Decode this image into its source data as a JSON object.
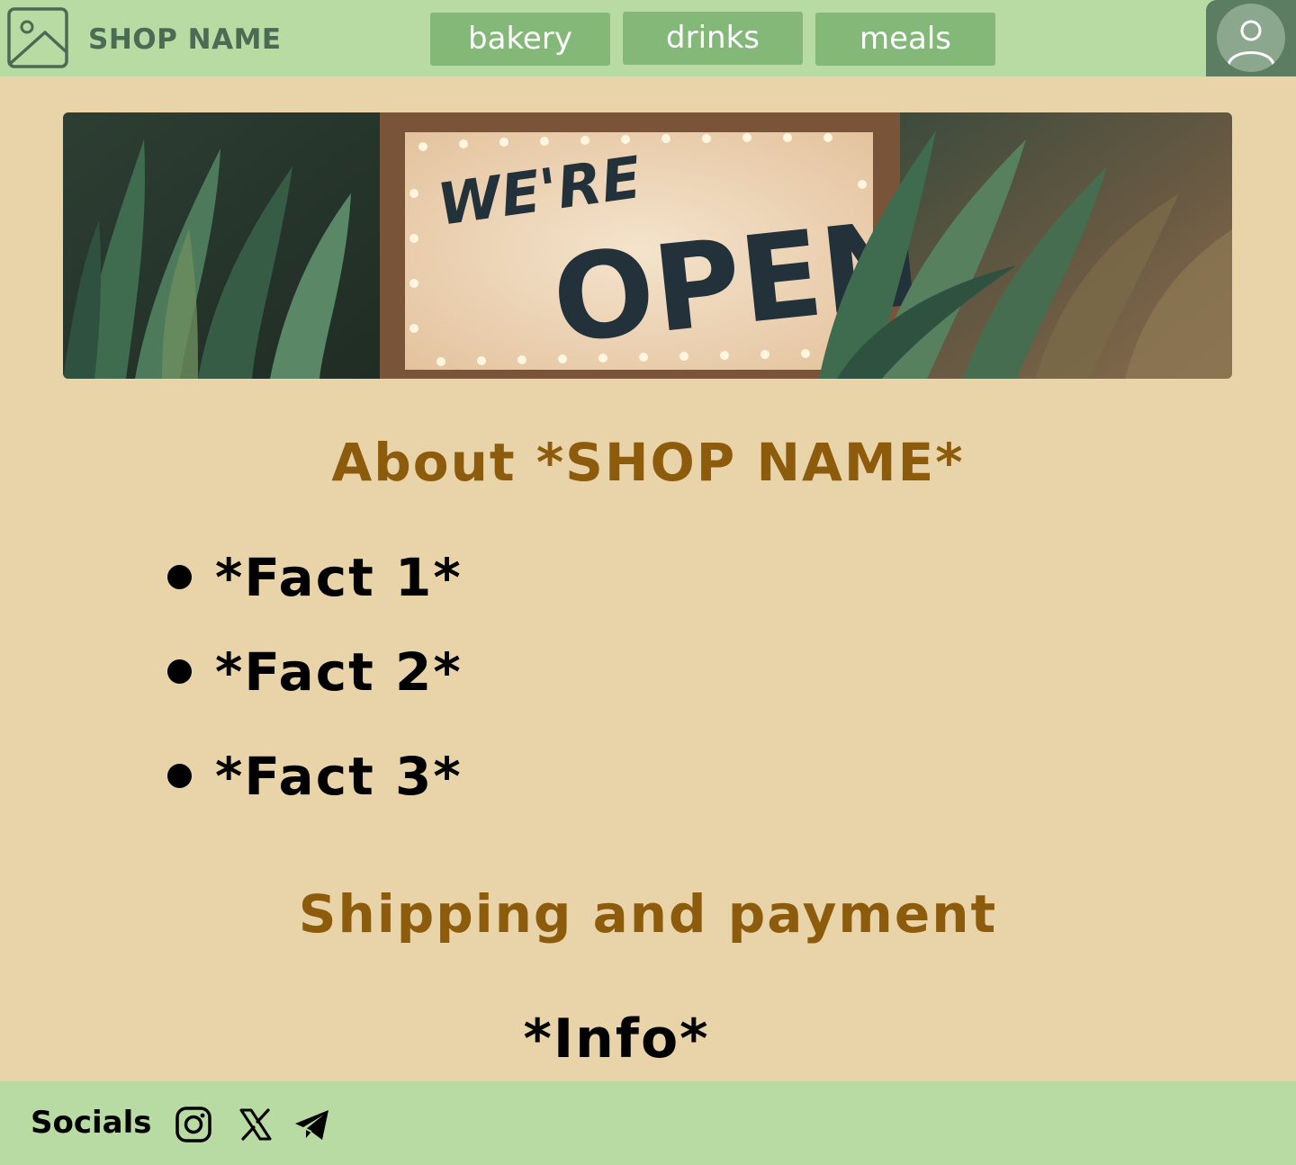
{
  "header": {
    "logo_icon": "image-placeholder-icon",
    "shop_name": "SHOP NAME",
    "nav": [
      {
        "label": "bakery"
      },
      {
        "label": "drinks"
      },
      {
        "label": "meals"
      }
    ],
    "profile_icon": "user-avatar-icon"
  },
  "hero": {
    "sign_line1": "WE'RE",
    "sign_line2": "OPEN"
  },
  "about": {
    "title": "About *SHOP NAME*",
    "facts": [
      "*Fact 1*",
      "*Fact 2*",
      "*Fact 3*"
    ]
  },
  "shipping": {
    "title": "Shipping and payment",
    "info": "*Info*"
  },
  "footer": {
    "socials_label": "Socials",
    "icons": [
      "instagram-icon",
      "x-icon",
      "telegram-icon"
    ]
  },
  "colors": {
    "page_bg": "#e9d4aa",
    "header_bg": "#b7dba2",
    "nav_button": "#84b879",
    "profile_bg": "#5d7d63",
    "heading": "#8d5b0c",
    "shop_name": "#4c6b55"
  }
}
